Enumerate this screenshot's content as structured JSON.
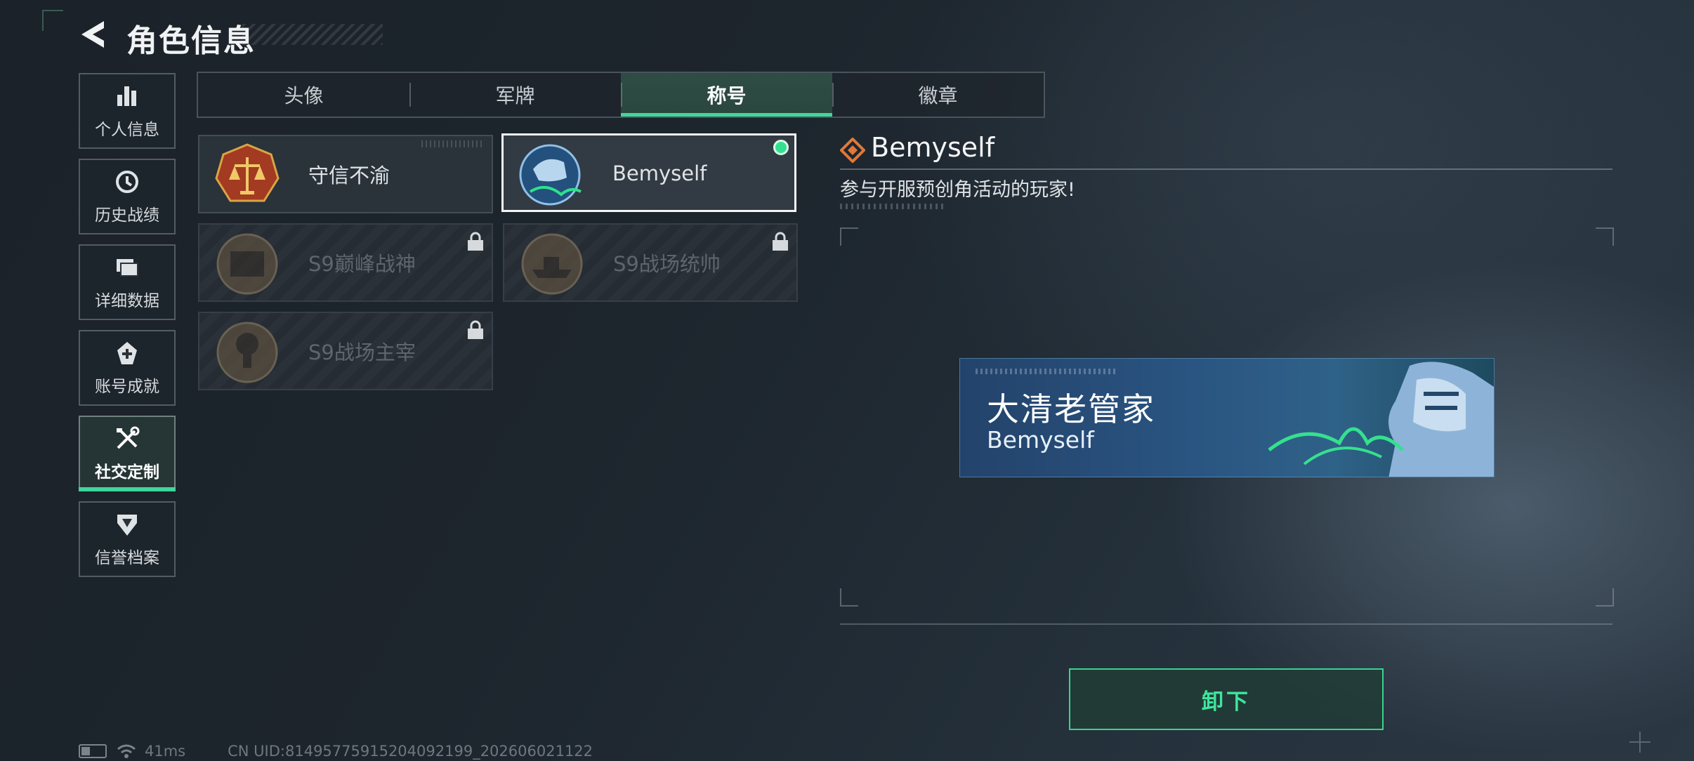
{
  "header": {
    "title": "角色信息"
  },
  "sidebar": {
    "items": [
      {
        "label": "个人信息",
        "icon": "bar-chart-icon"
      },
      {
        "label": "历史战绩",
        "icon": "clock-history-icon"
      },
      {
        "label": "详细数据",
        "icon": "folder-icon"
      },
      {
        "label": "账号成就",
        "icon": "achievement-icon"
      },
      {
        "label": "社交定制",
        "icon": "tools-icon",
        "active": true
      },
      {
        "label": "信誉档案",
        "icon": "reputation-icon"
      }
    ]
  },
  "tabs": [
    {
      "label": "头像"
    },
    {
      "label": "军牌"
    },
    {
      "label": "称号",
      "active": true
    },
    {
      "label": "徽章"
    }
  ],
  "titles": [
    {
      "name": "守信不渝",
      "locked": false
    },
    {
      "name": "Bemyself",
      "locked": false,
      "selected": true,
      "equipped": true
    },
    {
      "name": "S9巅峰战神",
      "locked": true
    },
    {
      "name": "S9战场统帅",
      "locked": true
    },
    {
      "name": "S9战场主宰",
      "locked": true
    }
  ],
  "detail": {
    "name": "Bemyself",
    "description": "参与开服预创角活动的玩家!",
    "banner_title": "大清老管家",
    "banner_subtitle": "Bemyself",
    "button_label": "卸下"
  },
  "status_bar": {
    "ping": "41ms",
    "uid": "CN UID:81495775915204092199_202606021122"
  },
  "colors": {
    "accent": "#3ed89a",
    "background": "#1d252d"
  }
}
